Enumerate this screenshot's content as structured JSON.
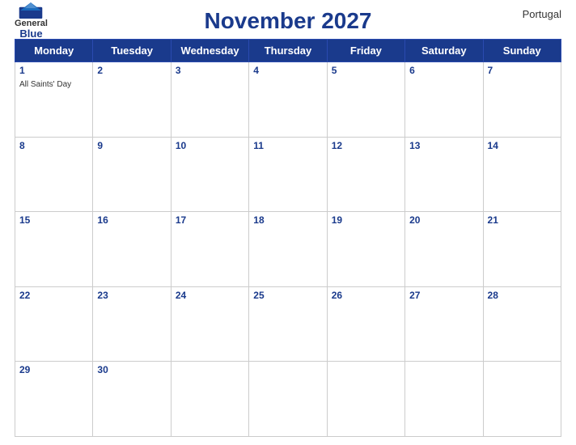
{
  "header": {
    "title": "November 2027",
    "country": "Portugal",
    "logo": {
      "general": "General",
      "blue": "Blue"
    }
  },
  "days_of_week": [
    "Monday",
    "Tuesday",
    "Wednesday",
    "Thursday",
    "Friday",
    "Saturday",
    "Sunday"
  ],
  "weeks": [
    [
      {
        "day": 1,
        "holiday": "All Saints' Day"
      },
      {
        "day": 2
      },
      {
        "day": 3
      },
      {
        "day": 4
      },
      {
        "day": 5
      },
      {
        "day": 6
      },
      {
        "day": 7
      }
    ],
    [
      {
        "day": 8
      },
      {
        "day": 9
      },
      {
        "day": 10
      },
      {
        "day": 11
      },
      {
        "day": 12
      },
      {
        "day": 13
      },
      {
        "day": 14
      }
    ],
    [
      {
        "day": 15
      },
      {
        "day": 16
      },
      {
        "day": 17
      },
      {
        "day": 18
      },
      {
        "day": 19
      },
      {
        "day": 20
      },
      {
        "day": 21
      }
    ],
    [
      {
        "day": 22
      },
      {
        "day": 23
      },
      {
        "day": 24
      },
      {
        "day": 25
      },
      {
        "day": 26
      },
      {
        "day": 27
      },
      {
        "day": 28
      }
    ],
    [
      {
        "day": 29
      },
      {
        "day": 30
      },
      {
        "day": null
      },
      {
        "day": null
      },
      {
        "day": null
      },
      {
        "day": null
      },
      {
        "day": null
      }
    ]
  ]
}
